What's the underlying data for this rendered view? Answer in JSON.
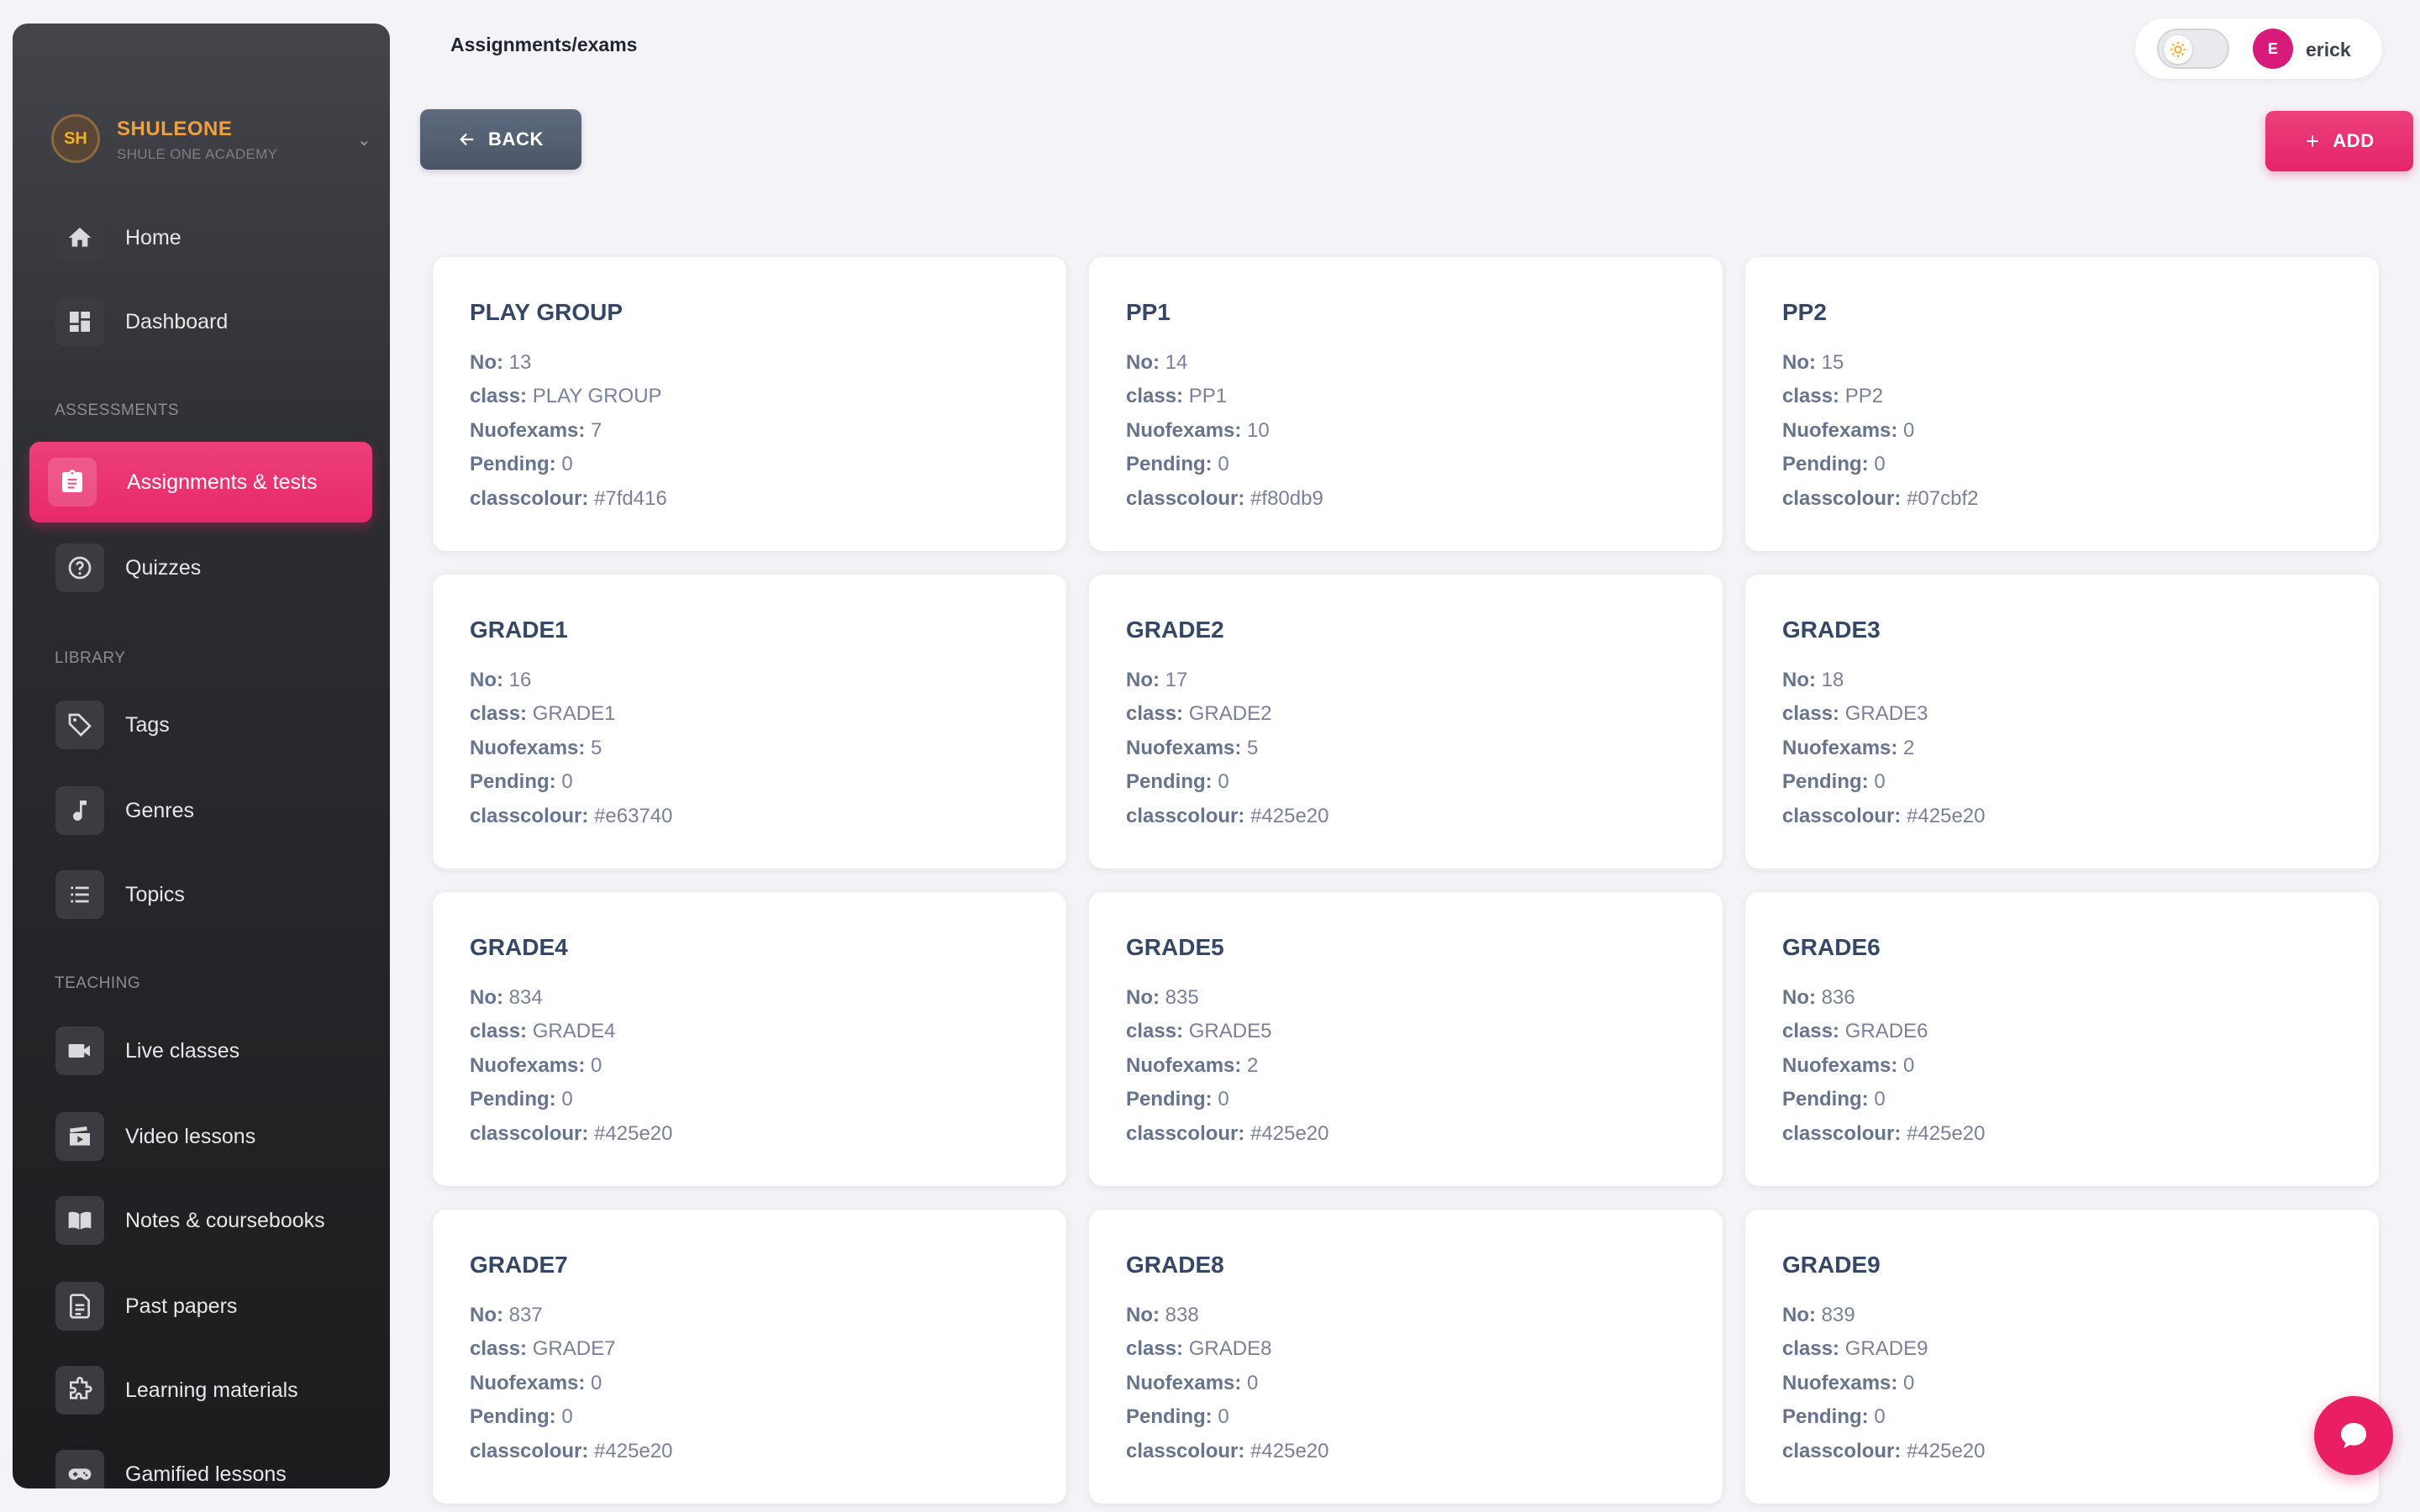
{
  "brand": {
    "initials": "SH",
    "name": "SHULEONE",
    "subtitle": "SHULE ONE ACADEMY"
  },
  "sidebar": {
    "items": [
      {
        "label": "Home",
        "icon": "home-icon"
      },
      {
        "label": "Dashboard",
        "icon": "dashboard-icon"
      },
      {
        "label": "Assignments & tests",
        "icon": "clipboard-icon",
        "active": true
      },
      {
        "label": "Quizzes",
        "icon": "question-icon"
      },
      {
        "label": "Tags",
        "icon": "tags-icon"
      },
      {
        "label": "Genres",
        "icon": "music-note-icon"
      },
      {
        "label": "Topics",
        "icon": "list-icon"
      },
      {
        "label": "Live classes",
        "icon": "video-camera-icon"
      },
      {
        "label": "Video lessons",
        "icon": "clapperboard-icon"
      },
      {
        "label": "Notes & coursebooks",
        "icon": "book-icon"
      },
      {
        "label": "Past papers",
        "icon": "document-icon"
      },
      {
        "label": "Learning materials",
        "icon": "puzzle-icon"
      },
      {
        "label": "Gamified lessons",
        "icon": "gamepad-icon"
      }
    ],
    "sections": {
      "assessments": "ASSESSMENTS",
      "library": "LIBRARY",
      "teaching": "TEACHING"
    }
  },
  "header": {
    "breadcrumb": "Assignments/exams",
    "user_initial": "E",
    "user_name": "erick"
  },
  "actions": {
    "back_label": "BACK",
    "add_label": "ADD"
  },
  "field_labels": {
    "no": "No:",
    "class": "class:",
    "nuofexams": "Nuofexams:",
    "pending": "Pending:",
    "classcolour": "classcolour:"
  },
  "cards": [
    {
      "title": "PLAY GROUP",
      "no": "13",
      "class": "PLAY GROUP",
      "nuofexams": "7",
      "pending": "0",
      "classcolour": "#7fd416"
    },
    {
      "title": "PP1",
      "no": "14",
      "class": "PP1",
      "nuofexams": "10",
      "pending": "0",
      "classcolour": "#f80db9"
    },
    {
      "title": "PP2",
      "no": "15",
      "class": "PP2",
      "nuofexams": "0",
      "pending": "0",
      "classcolour": "#07cbf2"
    },
    {
      "title": "GRADE1",
      "no": "16",
      "class": "GRADE1",
      "nuofexams": "5",
      "pending": "0",
      "classcolour": "#e63740"
    },
    {
      "title": "GRADE2",
      "no": "17",
      "class": "GRADE2",
      "nuofexams": "5",
      "pending": "0",
      "classcolour": "#425e20"
    },
    {
      "title": "GRADE3",
      "no": "18",
      "class": "GRADE3",
      "nuofexams": "2",
      "pending": "0",
      "classcolour": "#425e20"
    },
    {
      "title": "GRADE4",
      "no": "834",
      "class": "GRADE4",
      "nuofexams": "0",
      "pending": "0",
      "classcolour": "#425e20"
    },
    {
      "title": "GRADE5",
      "no": "835",
      "class": "GRADE5",
      "nuofexams": "2",
      "pending": "0",
      "classcolour": "#425e20"
    },
    {
      "title": "GRADE6",
      "no": "836",
      "class": "GRADE6",
      "nuofexams": "0",
      "pending": "0",
      "classcolour": "#425e20"
    },
    {
      "title": "GRADE7",
      "no": "837",
      "class": "GRADE7",
      "nuofexams": "0",
      "pending": "0",
      "classcolour": "#425e20"
    },
    {
      "title": "GRADE8",
      "no": "838",
      "class": "GRADE8",
      "nuofexams": "0",
      "pending": "0",
      "classcolour": "#425e20"
    },
    {
      "title": "GRADE9",
      "no": "839",
      "class": "GRADE9",
      "nuofexams": "0",
      "pending": "0",
      "classcolour": "#425e20"
    }
  ],
  "colors": {
    "accent": "#e91e63",
    "sidebar_bg": "#2b2c30",
    "back_button": "#55627a",
    "brand_text": "#f0a03c"
  }
}
